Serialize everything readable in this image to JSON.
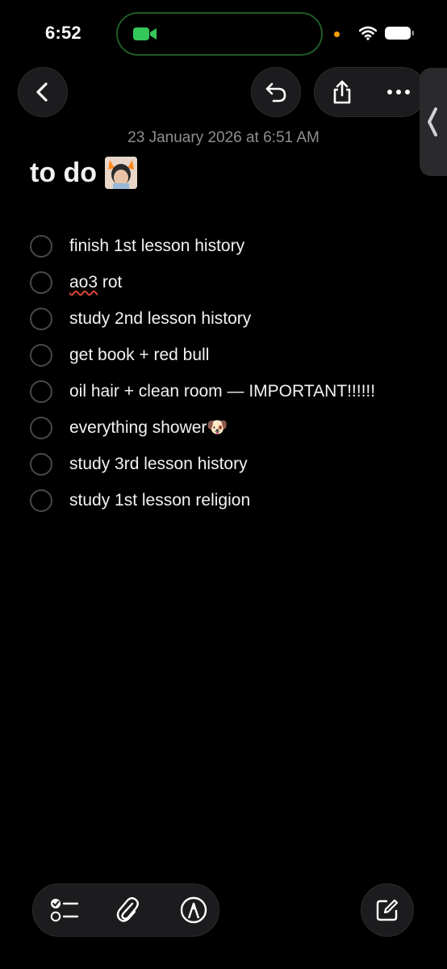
{
  "status_bar": {
    "time": "6:52",
    "facetime_color": "#34c759",
    "dot_color": "#ff9f0a"
  },
  "nav": {
    "back_icon": "chevron-left-icon",
    "undo_icon": "undo-icon",
    "share_icon": "share-icon",
    "more_icon": "ellipsis-icon",
    "side_tab_icon": "chevron-left-icon"
  },
  "note": {
    "date": "23 January 2026 at 6:51 AM",
    "title": "to do",
    "title_sticker": "sticker-image",
    "items": [
      {
        "text": "finish 1st lesson history",
        "checked": false
      },
      {
        "text": "ao3 rot",
        "checked": false
      },
      {
        "text": "study 2nd lesson history",
        "checked": false
      },
      {
        "text": "get book + red bull",
        "checked": false
      },
      {
        "text": "oil hair + clean room — IMPORTANT!!!!!!",
        "checked": false
      },
      {
        "text": "everything shower🐶",
        "checked": false
      },
      {
        "text": "study 3rd lesson history",
        "checked": false
      },
      {
        "text": "study 1st lesson religion",
        "checked": false
      }
    ]
  },
  "toolbar": {
    "checklist_icon": "checklist-icon",
    "attach_icon": "paperclip-icon",
    "markup_icon": "markup-pen-icon",
    "compose_icon": "compose-icon"
  }
}
